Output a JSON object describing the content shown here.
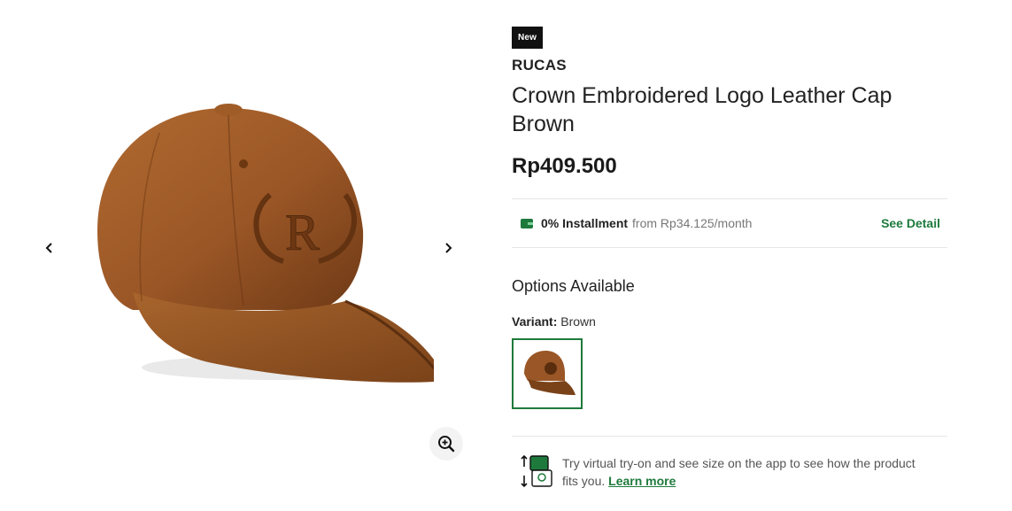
{
  "gallery": {
    "prev_icon": "chevron-left-icon",
    "next_icon": "chevron-right-icon",
    "zoom_icon": "zoom-in-icon",
    "image_alt": "Crown Embroidered Logo Leather Cap Brown"
  },
  "product": {
    "badge": "New",
    "brand": "RUCAS",
    "title": "Crown Embroidered Logo Leather Cap Brown",
    "price": "Rp409.500"
  },
  "installment": {
    "icon": "wallet-icon",
    "label": "0% Installment",
    "detail": "from Rp34.125/month",
    "link": "See Detail"
  },
  "options": {
    "title": "Options Available",
    "variant_label": "Variant:",
    "variant_value": "Brown"
  },
  "tryon": {
    "icon": "virtual-try-on-icon",
    "text": "Try virtual try-on and see size on the app to see how the product fits you.",
    "link": "Learn more"
  },
  "colors": {
    "accent": "#1e7a3c",
    "badge_bg": "#111111",
    "leather": "#9a5a2a"
  }
}
